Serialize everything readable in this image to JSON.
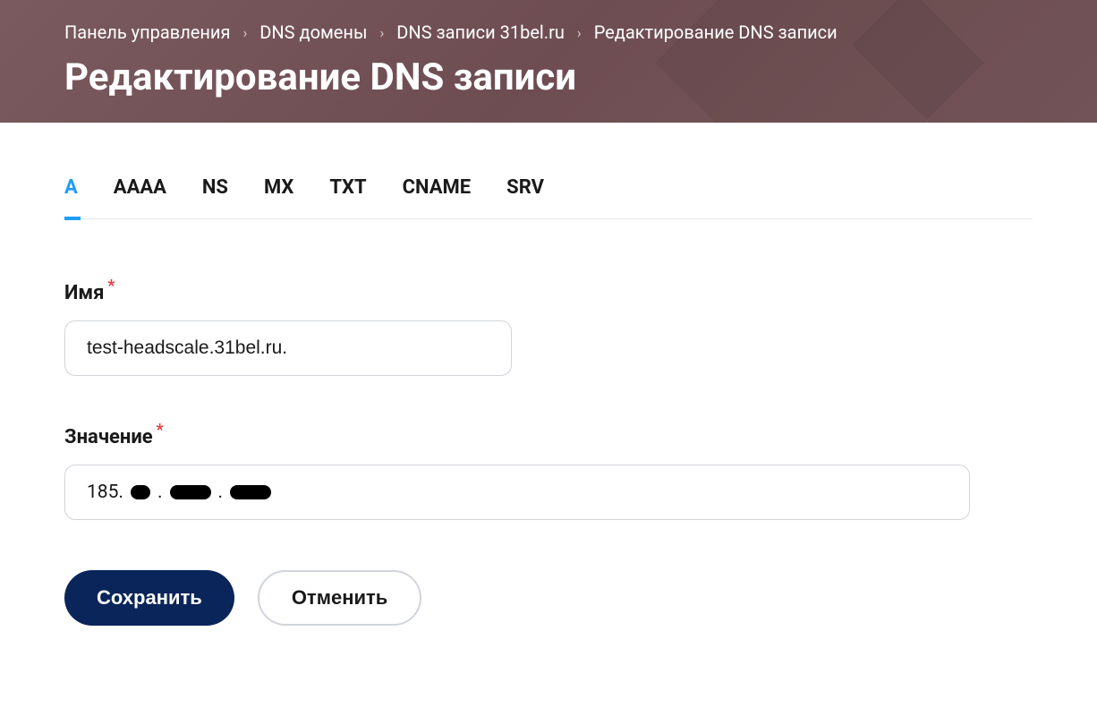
{
  "breadcrumb": {
    "items": [
      {
        "label": "Панель управления"
      },
      {
        "label": "DNS домены"
      },
      {
        "label": "DNS записи 31bel.ru"
      },
      {
        "label": "Редактирование DNS записи"
      }
    ]
  },
  "page_title": "Редактирование DNS записи",
  "tabs": {
    "items": [
      {
        "label": "A",
        "active": true
      },
      {
        "label": "AAAA"
      },
      {
        "label": "NS"
      },
      {
        "label": "MX"
      },
      {
        "label": "TXT"
      },
      {
        "label": "CNAME"
      },
      {
        "label": "SRV"
      }
    ]
  },
  "form": {
    "name": {
      "label": "Имя",
      "required": "*",
      "value": "test-headscale.31bel.ru."
    },
    "value": {
      "label": "Значение",
      "required": "*",
      "value_prefix": "185.",
      "dot1": ".",
      "dot2": "."
    }
  },
  "actions": {
    "save": "Сохранить",
    "cancel": "Отменить"
  }
}
